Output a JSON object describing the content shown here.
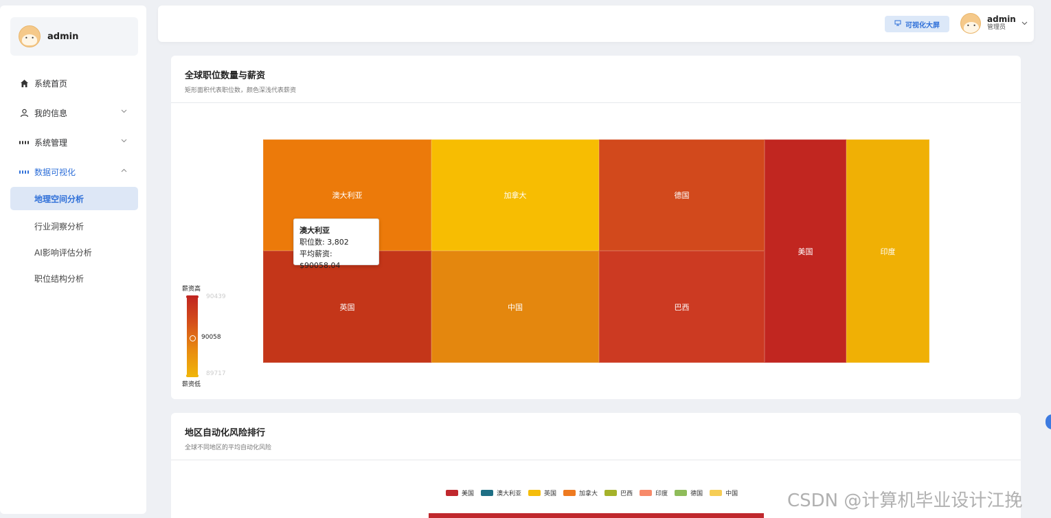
{
  "sidebar": {
    "user": {
      "name": "admin"
    },
    "items": [
      {
        "label": "系统首页",
        "icon": "home-icon"
      },
      {
        "label": "我的信息",
        "icon": "user-icon"
      },
      {
        "label": "系统管理",
        "icon": "grid-icon"
      },
      {
        "label": "数据可视化",
        "icon": "grid-icon"
      }
    ],
    "sub_items": [
      {
        "label": "地理空间分析",
        "selected": true
      },
      {
        "label": "行业洞察分析"
      },
      {
        "label": "AI影响评估分析"
      },
      {
        "label": "职位结构分析"
      }
    ]
  },
  "header": {
    "screen_button": "可视化大屏",
    "user_name": "admin",
    "user_role": "管理员"
  },
  "card1": {
    "title": "全球职位数量与薪资",
    "subtitle": "矩形面积代表职位数，颜色深浅代表薪资",
    "tooltip": {
      "title": "澳大利亚",
      "line1": "职位数: 3,802",
      "line2": "平均薪资: $90058.04"
    },
    "visual_map": {
      "high_label": "薪资高",
      "low_label": "薪资低",
      "max": "90439",
      "min": "89717",
      "current": "90058"
    }
  },
  "chart_data": {
    "type": "heatmap",
    "title": "全球职位数量与薪资",
    "subtitle": "矩形面积代表职位数，颜色深浅代表薪资",
    "labels": [
      "澳大利亚",
      "加拿大",
      "德国",
      "英国",
      "中国",
      "巴西",
      "美国",
      "印度"
    ],
    "known_values": {
      "澳大利亚": {
        "jobs": 3802,
        "avg_salary": 90058.04
      }
    },
    "color_range": [
      89717,
      90439
    ],
    "colors": {
      "澳大利亚": "#ec7a0a",
      "加拿大": "#f7bd02",
      "德国": "#d2491c",
      "英国": "#c43619",
      "中国": "#e4870e",
      "巴西": "#cc3a22",
      "美国": "#c12620",
      "印度": "#f0b005"
    }
  },
  "card2": {
    "title": "地区自动化风险排行",
    "subtitle": "全球不同地区的平均自动化风险",
    "legend": [
      {
        "name": "美国",
        "color": "#c0282d"
      },
      {
        "name": "澳大利亚",
        "color": "#1e6f84"
      },
      {
        "name": "英国",
        "color": "#f5bd0b"
      },
      {
        "name": "加拿大",
        "color": "#ee7a20"
      },
      {
        "name": "巴西",
        "color": "#a5b22a"
      },
      {
        "name": "印度",
        "color": "#f78a6a"
      },
      {
        "name": "德国",
        "color": "#8fbc5a"
      },
      {
        "name": "中国",
        "color": "#f6cd55"
      }
    ]
  },
  "watermark": "CSDN @计算机毕业设计江挽"
}
